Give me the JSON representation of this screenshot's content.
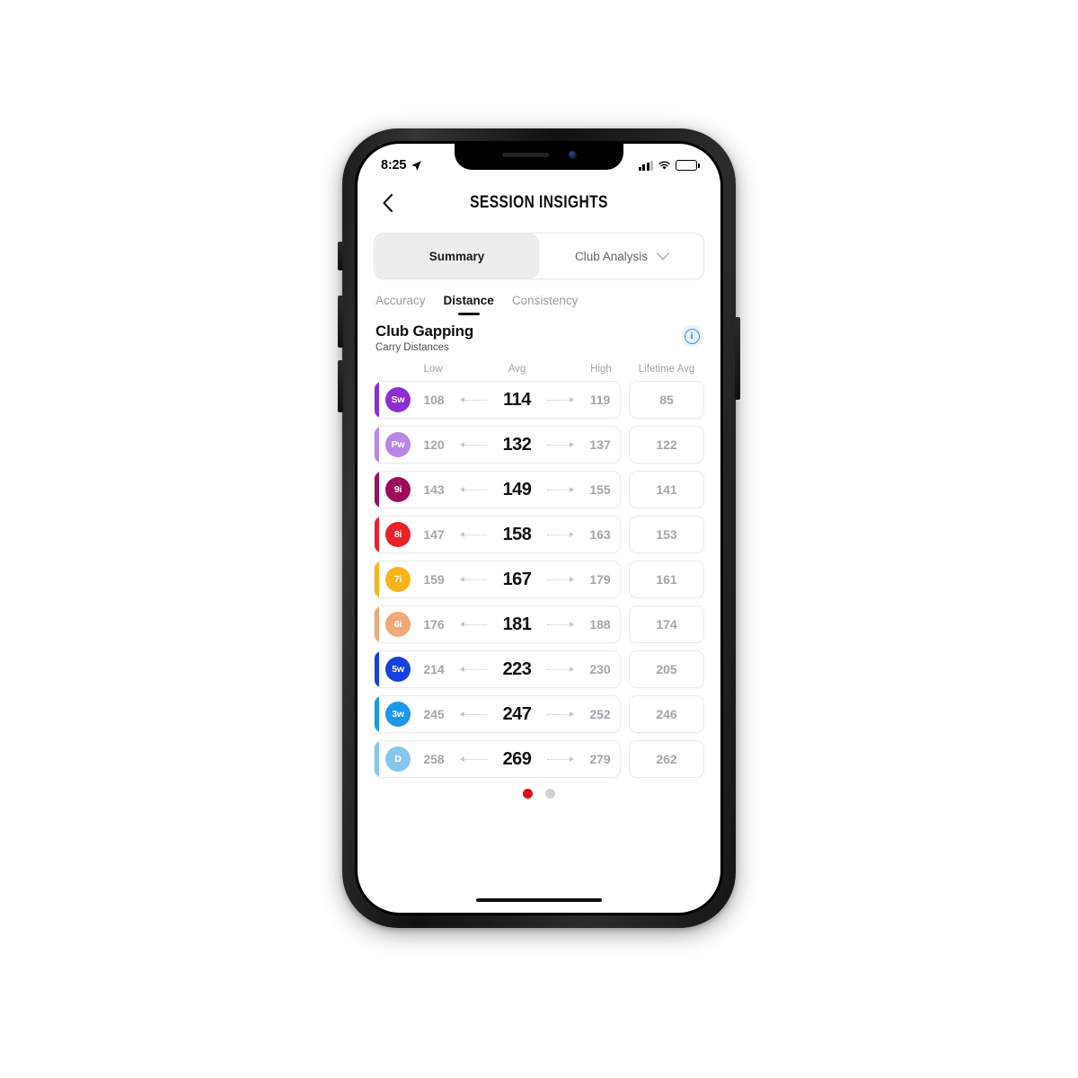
{
  "status_bar": {
    "time": "8:25",
    "location_icon": "location-arrow-icon",
    "signal_icon": "cellular-signal-icon",
    "wifi_icon": "wifi-icon",
    "battery_icon": "battery-icon"
  },
  "header": {
    "back_icon": "chevron-left-icon",
    "title": "SESSION INSIGHTS"
  },
  "segmented_control": {
    "segments": [
      {
        "label": "Summary",
        "active": true
      },
      {
        "label": "Club Analysis",
        "active": false,
        "icon": "chevron-down-icon"
      }
    ]
  },
  "sub_tabs": [
    {
      "label": "Accuracy",
      "active": false
    },
    {
      "label": "Distance",
      "active": true
    },
    {
      "label": "Consistency",
      "active": false
    }
  ],
  "section": {
    "title": "Club Gapping",
    "subtitle": "Carry Distances",
    "info_icon": "info-icon",
    "info_glyph": "i"
  },
  "table": {
    "columns": [
      "Low",
      "Avg",
      "High",
      "Lifetime Avg"
    ],
    "rows": [
      {
        "club": "Sw",
        "low": "108",
        "avg": "114",
        "high": "119",
        "lifetime": "85",
        "color": "#8b2fd4"
      },
      {
        "club": "Pw",
        "low": "120",
        "avg": "132",
        "high": "137",
        "lifetime": "122",
        "color": "#b986e8"
      },
      {
        "club": "9i",
        "low": "143",
        "avg": "149",
        "high": "155",
        "lifetime": "141",
        "color": "#9e0d5c"
      },
      {
        "club": "8i",
        "low": "147",
        "avg": "158",
        "high": "163",
        "lifetime": "153",
        "color": "#ea2128"
      },
      {
        "club": "7i",
        "low": "159",
        "avg": "167",
        "high": "179",
        "lifetime": "161",
        "color": "#f7b418"
      },
      {
        "club": "6i",
        "low": "176",
        "avg": "181",
        "high": "188",
        "lifetime": "174",
        "color": "#f2a878"
      },
      {
        "club": "5w",
        "low": "214",
        "avg": "223",
        "high": "230",
        "lifetime": "205",
        "color": "#1641dd"
      },
      {
        "club": "3w",
        "low": "245",
        "avg": "247",
        "high": "252",
        "lifetime": "246",
        "color": "#1d97ea"
      },
      {
        "club": "D",
        "low": "258",
        "avg": "269",
        "high": "279",
        "lifetime": "262",
        "color": "#85c7ec"
      }
    ]
  },
  "page_dots": [
    {
      "active": true,
      "color": "#e20e17"
    },
    {
      "active": false,
      "color": "#d2d3d5"
    }
  ]
}
